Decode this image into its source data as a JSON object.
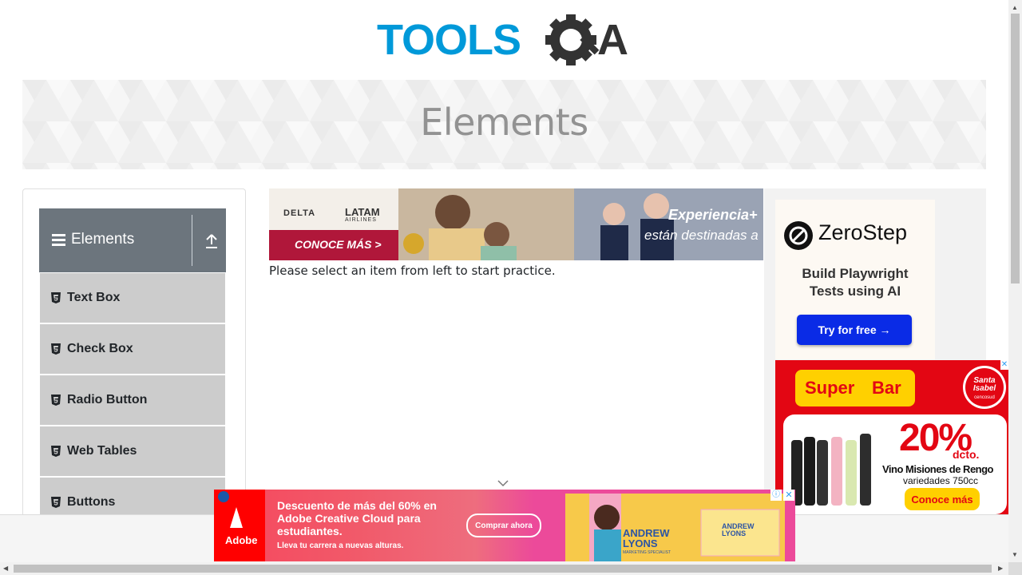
{
  "logo": {
    "text_left": "TOOLS",
    "text_right": "A"
  },
  "banner": {
    "title": "Elements"
  },
  "sidebar": {
    "group_title": "Elements",
    "items": [
      {
        "label": "Text Box"
      },
      {
        "label": "Check Box"
      },
      {
        "label": "Radio Button"
      },
      {
        "label": "Web Tables"
      },
      {
        "label": "Buttons"
      }
    ]
  },
  "main": {
    "instruction": "Please select an item from left to start practice."
  },
  "ads": {
    "top": {
      "brand_delta": "DELTA",
      "brand_latam": "LATAM",
      "brand_latam_sub": "AIRLINES",
      "cta": "CONOCE MÁS >",
      "headline": "Experiencia+",
      "subline": "están destinadas a"
    },
    "zerostep": {
      "brand": "ZeroStep",
      "tagline_1": "Build Playwright",
      "tagline_2": "Tests using AI",
      "cta": "Try for free →"
    },
    "superbar": {
      "brand": "Super",
      "brand_2": "Bar",
      "store": "Santa Isabel",
      "store_sub": "cencosud",
      "discount": "20%",
      "discount_sub": "dcto.",
      "product": "Vino Misiones de Rengo",
      "product_sub": "variedades 750cc",
      "cta": "Conoce más"
    },
    "adobe": {
      "brand": "Adobe",
      "headline_1": "Descuento de más del 60% en",
      "headline_2": "Adobe Creative Cloud para",
      "headline_3": "estudiantes.",
      "sub": "Lleva tu carrera a nuevas alturas.",
      "cta": "Comprar ahora",
      "card_name_1": "ANDREW",
      "card_name_2": "LYONS",
      "card_role": "MARKETING SPECIALIST"
    }
  },
  "colors": {
    "header_bg": "#6c757d",
    "menu_bg": "#cccccc",
    "logo_blue": "#0099d9",
    "logo_dark": "#333333",
    "zs_cta": "#0a2be6",
    "sb_red": "#e30613"
  }
}
